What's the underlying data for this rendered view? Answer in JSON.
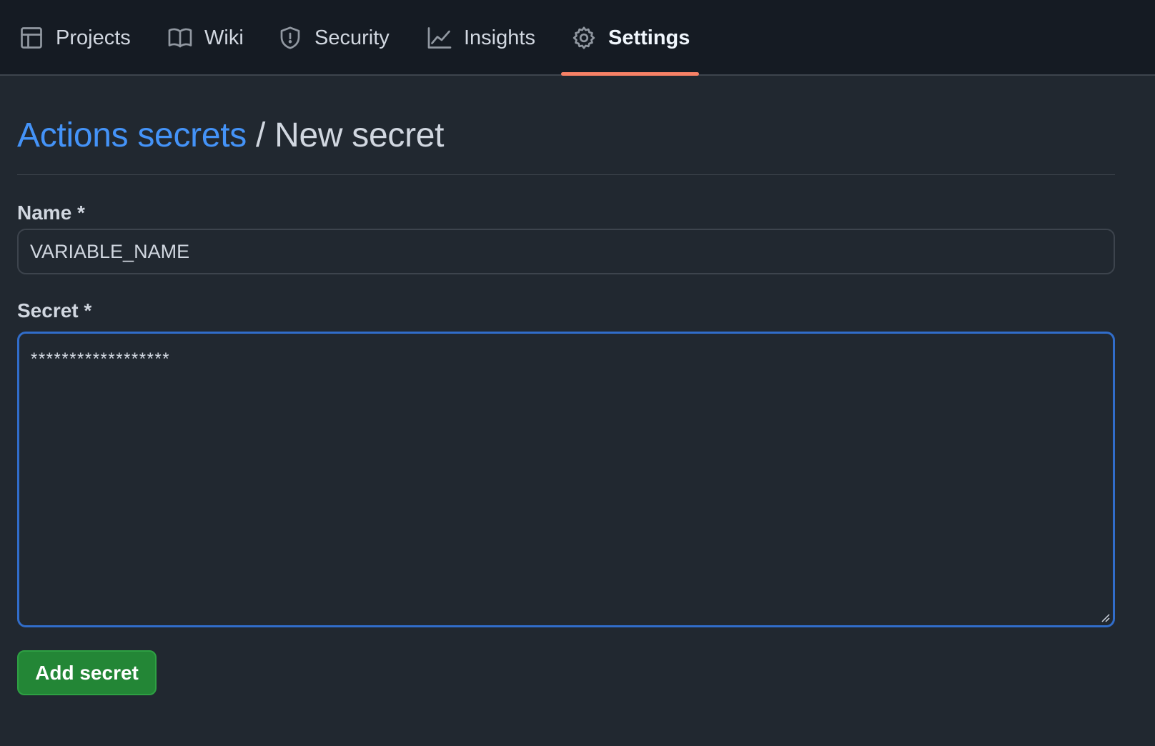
{
  "nav": {
    "tabs": [
      {
        "label": "Projects",
        "icon": "table-icon"
      },
      {
        "label": "Wiki",
        "icon": "book-icon"
      },
      {
        "label": "Security",
        "icon": "shield-icon"
      },
      {
        "label": "Insights",
        "icon": "graph-icon"
      },
      {
        "label": "Settings",
        "icon": "gear-icon",
        "active": true
      }
    ]
  },
  "page": {
    "breadcrumb_link": "Actions secrets",
    "separator": "/",
    "title": "New secret"
  },
  "form": {
    "name_label": "Name *",
    "name_value": "VARIABLE_NAME",
    "secret_label": "Secret *",
    "secret_value": "******************",
    "submit_label": "Add secret"
  },
  "colors": {
    "accent_link": "#4493f8",
    "active_tab_underline": "#f78166",
    "focus_border": "#316dca",
    "primary_button": "#238636"
  }
}
